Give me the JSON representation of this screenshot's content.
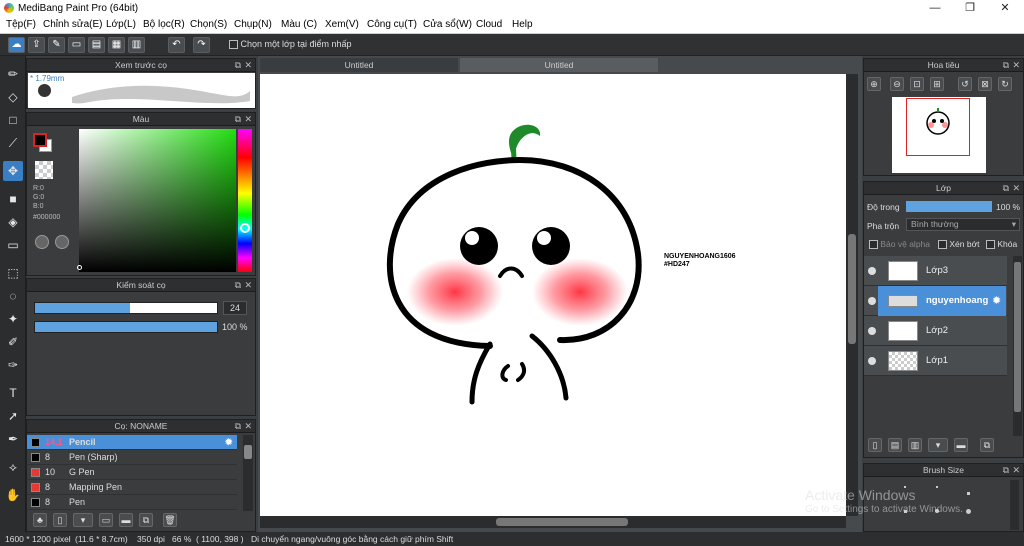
{
  "window": {
    "title": "MediBang Paint Pro (64bit)",
    "minimize": "—",
    "maximize": "❐",
    "close": "✕"
  },
  "menu": [
    "Tệp(F)",
    "Chỉnh sửa(E)",
    "Lớp(L)",
    "Bộ lọc(R)",
    "Chọn(S)",
    "Chụp(N)",
    "Màu (C)",
    "Xem(V)",
    "Công cụ(T)",
    "Cửa sổ(W)",
    "Cloud",
    "Help"
  ],
  "toolbar": {
    "select_layer_label": "Chọn một lớp tại điểm nhấp"
  },
  "tabs": [
    "Untitled",
    "Untitled"
  ],
  "brush_preview": {
    "title": "Xem trước cọ",
    "size": "* 1.79mm"
  },
  "color": {
    "title": "Màu",
    "r": "R:0",
    "g": "G:0",
    "b": "B:0",
    "hex": "#000000",
    "primary": "#000000",
    "secondary": "#ffffff"
  },
  "brush_control": {
    "title": "Kiểm soát cọ",
    "size": "24",
    "size_fraction": 0.52,
    "opacity": "100 %",
    "opacity_fraction": 1.0
  },
  "brush_list": {
    "title": "Cọ: NONAME",
    "items": [
      {
        "size": "14.1",
        "name": "Pencil",
        "color": "#000000",
        "selected": true
      },
      {
        "size": "8",
        "name": "Pen (Sharp)",
        "color": "#000000",
        "selected": false
      },
      {
        "size": "10",
        "name": "G Pen",
        "color": "#e53935",
        "selected": false
      },
      {
        "size": "8",
        "name": "Mapping Pen",
        "color": "#e53935",
        "selected": false
      },
      {
        "size": "8",
        "name": "Pen",
        "color": "#000000",
        "selected": false
      }
    ]
  },
  "navigator": {
    "title": "Hoa tiêu"
  },
  "layers": {
    "title": "Lớp",
    "opacity_label": "Độ trong",
    "opacity_value": "100 %",
    "blend_label": "Pha trộn",
    "blend_value": "Bình thường",
    "protect_alpha": "Bảo vệ alpha",
    "clipping": "Xén bớt",
    "lock": "Khóa",
    "items": [
      {
        "name": "Lớp3",
        "selected": false
      },
      {
        "name": "nguyenhoang",
        "selected": true
      },
      {
        "name": "Lớp2",
        "selected": false
      },
      {
        "name": "Lớp1",
        "selected": false
      }
    ]
  },
  "brush_size": {
    "title": "Brush Size"
  },
  "artwork": {
    "signature_line1": "NGUYENHOANG1606",
    "signature_line2": "#HD247"
  },
  "watermark": {
    "line1": "Activate Windows",
    "line2": "Go to Settings to activate Windows."
  },
  "status": {
    "dimensions": "1600 * 1200 pixel",
    "physical": "(11.6 * 8.7cm)",
    "dpi": "350 dpi",
    "zoom": "66 %",
    "coords": "( 1100, 398 )",
    "hint": "Di chuyển ngang/vuông góc bằng cách giữ phím Shift"
  }
}
